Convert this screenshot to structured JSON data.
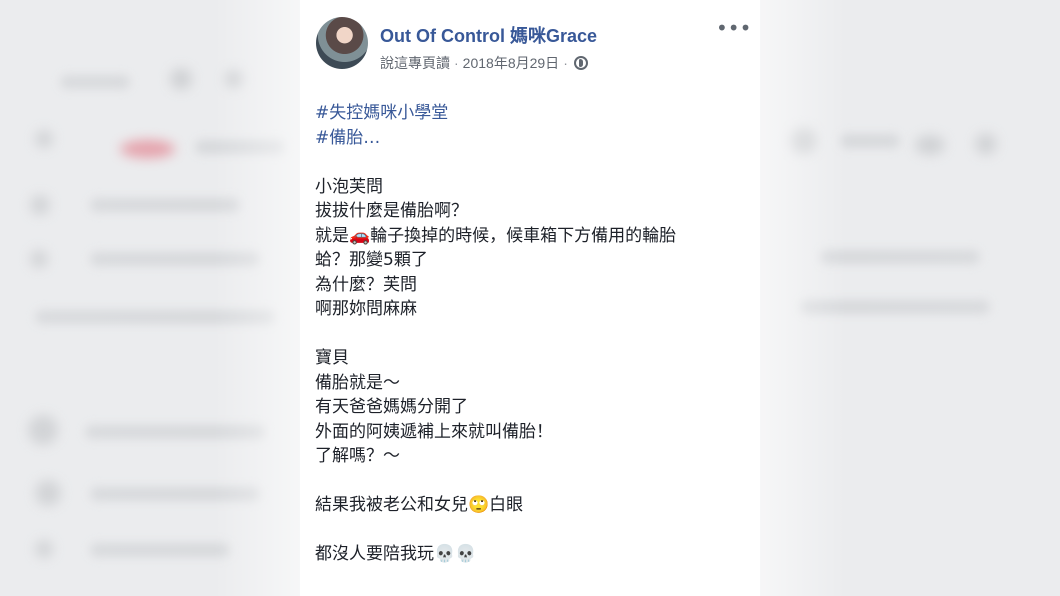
{
  "post": {
    "author": "Out Of Control 媽咪Grace",
    "meta": {
      "via": "說這專頁讀",
      "date": "2018年8月29日",
      "separator": "·"
    },
    "more_icon": "more-options-icon",
    "privacy_icon": "globe-icon",
    "lines": [
      {
        "text": "#失控媽咪小學堂",
        "kind": "tag"
      },
      {
        "text": "#備胎…",
        "kind": "tag"
      },
      {
        "text": "",
        "kind": "gap"
      },
      {
        "text": "小泡芙問",
        "kind": "text"
      },
      {
        "text": "拔拔什麼是備胎啊？",
        "kind": "text"
      },
      {
        "text": "就是🚗輪子換掉的時候，候車箱下方備用的輪胎",
        "kind": "text"
      },
      {
        "text": "蛤？那變5顆了",
        "kind": "text"
      },
      {
        "text": "為什麼？芙問",
        "kind": "text"
      },
      {
        "text": "啊那妳問麻麻",
        "kind": "text"
      },
      {
        "text": "",
        "kind": "gap"
      },
      {
        "text": "寶貝",
        "kind": "text"
      },
      {
        "text": "備胎就是～",
        "kind": "text"
      },
      {
        "text": "有天爸爸媽媽分開了",
        "kind": "text"
      },
      {
        "text": "外面的阿姨遞補上來就叫備胎！",
        "kind": "text"
      },
      {
        "text": "了解嗎？～",
        "kind": "text"
      },
      {
        "text": "",
        "kind": "gap"
      },
      {
        "text": "結果我被老公和女兒🙄白眼",
        "kind": "text"
      },
      {
        "text": "",
        "kind": "gap"
      },
      {
        "text": "都沒人要陪我玩💀💀",
        "kind": "text"
      }
    ]
  }
}
